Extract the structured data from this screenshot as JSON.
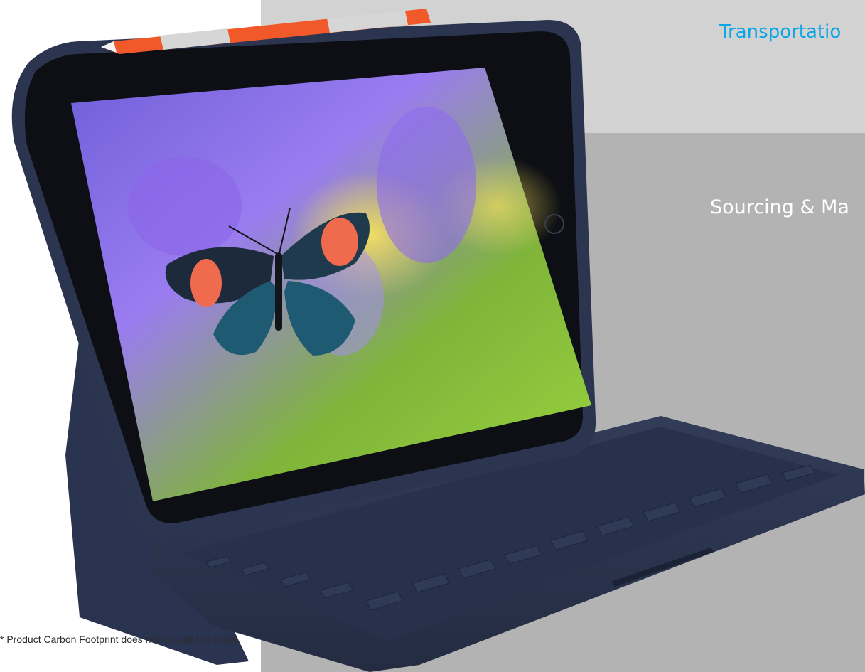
{
  "sections": {
    "transportation_label": "Transportatio",
    "sourcing_label": "Sourcing & Ma"
  },
  "footnote": "* Product Carbon Footprint does not include the tablet",
  "icons": {
    "product": "tablet-keyboard-case-image",
    "stylus": "stylus-pencil-icon",
    "butterfly": "butterfly-image"
  },
  "colors": {
    "accent_blue": "#0aa6e6",
    "case_navy": "#2b3550",
    "pencil_orange": "#f1592a",
    "panel_light": "#d2d2d2",
    "panel_dark": "#b3b3b3"
  }
}
